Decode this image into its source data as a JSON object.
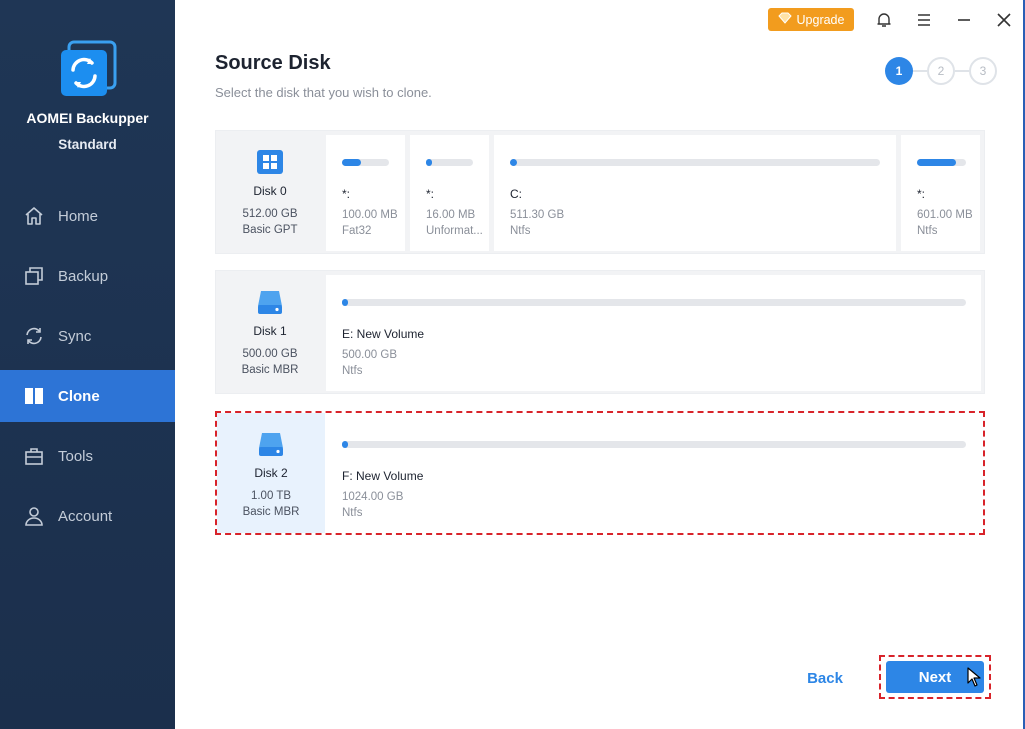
{
  "app": {
    "name": "AOMEI Backupper",
    "edition": "Standard"
  },
  "titlebar": {
    "upgrade_label": "Upgrade"
  },
  "sidebar": {
    "items": [
      {
        "label": "Home",
        "icon": "home-icon"
      },
      {
        "label": "Backup",
        "icon": "backup-icon"
      },
      {
        "label": "Sync",
        "icon": "sync-icon"
      },
      {
        "label": "Clone",
        "icon": "clone-icon",
        "active": true
      },
      {
        "label": "Tools",
        "icon": "tools-icon"
      },
      {
        "label": "Account",
        "icon": "account-icon"
      }
    ]
  },
  "header": {
    "title": "Source Disk",
    "subtitle": "Select the disk that you wish to clone."
  },
  "steps": [
    "1",
    "2",
    "3"
  ],
  "disks": [
    {
      "name": "Disk 0",
      "size": "512.00 GB",
      "type": "Basic GPT",
      "partitions": [
        {
          "name": "*:",
          "size": "100.00 MB",
          "fs": "Fat32",
          "used": 0.4
        },
        {
          "name": "*:",
          "size": "16.00 MB",
          "fs": "Unformat...",
          "used": 0.05
        },
        {
          "name": "C:",
          "size": "511.30 GB",
          "fs": "Ntfs",
          "used": 0.02
        },
        {
          "name": "*:",
          "size": "601.00 MB",
          "fs": "Ntfs",
          "used": 0.8
        }
      ]
    },
    {
      "name": "Disk 1",
      "size": "500.00 GB",
      "type": "Basic MBR",
      "partitions": [
        {
          "name": "E: New Volume",
          "size": "500.00 GB",
          "fs": "Ntfs",
          "used": 0.005
        }
      ]
    },
    {
      "name": "Disk 2",
      "size": "1.00 TB",
      "type": "Basic MBR",
      "selected": true,
      "partitions": [
        {
          "name": "F: New Volume",
          "size": "1024.00 GB",
          "fs": "Ntfs",
          "used": 0.005
        }
      ]
    }
  ],
  "footer": {
    "back_label": "Back",
    "next_label": "Next"
  },
  "colors": {
    "accent": "#2d86e6",
    "sidebar_bg": "#1f3655",
    "upgrade": "#f29c1e",
    "highlight": "#d8232a"
  }
}
